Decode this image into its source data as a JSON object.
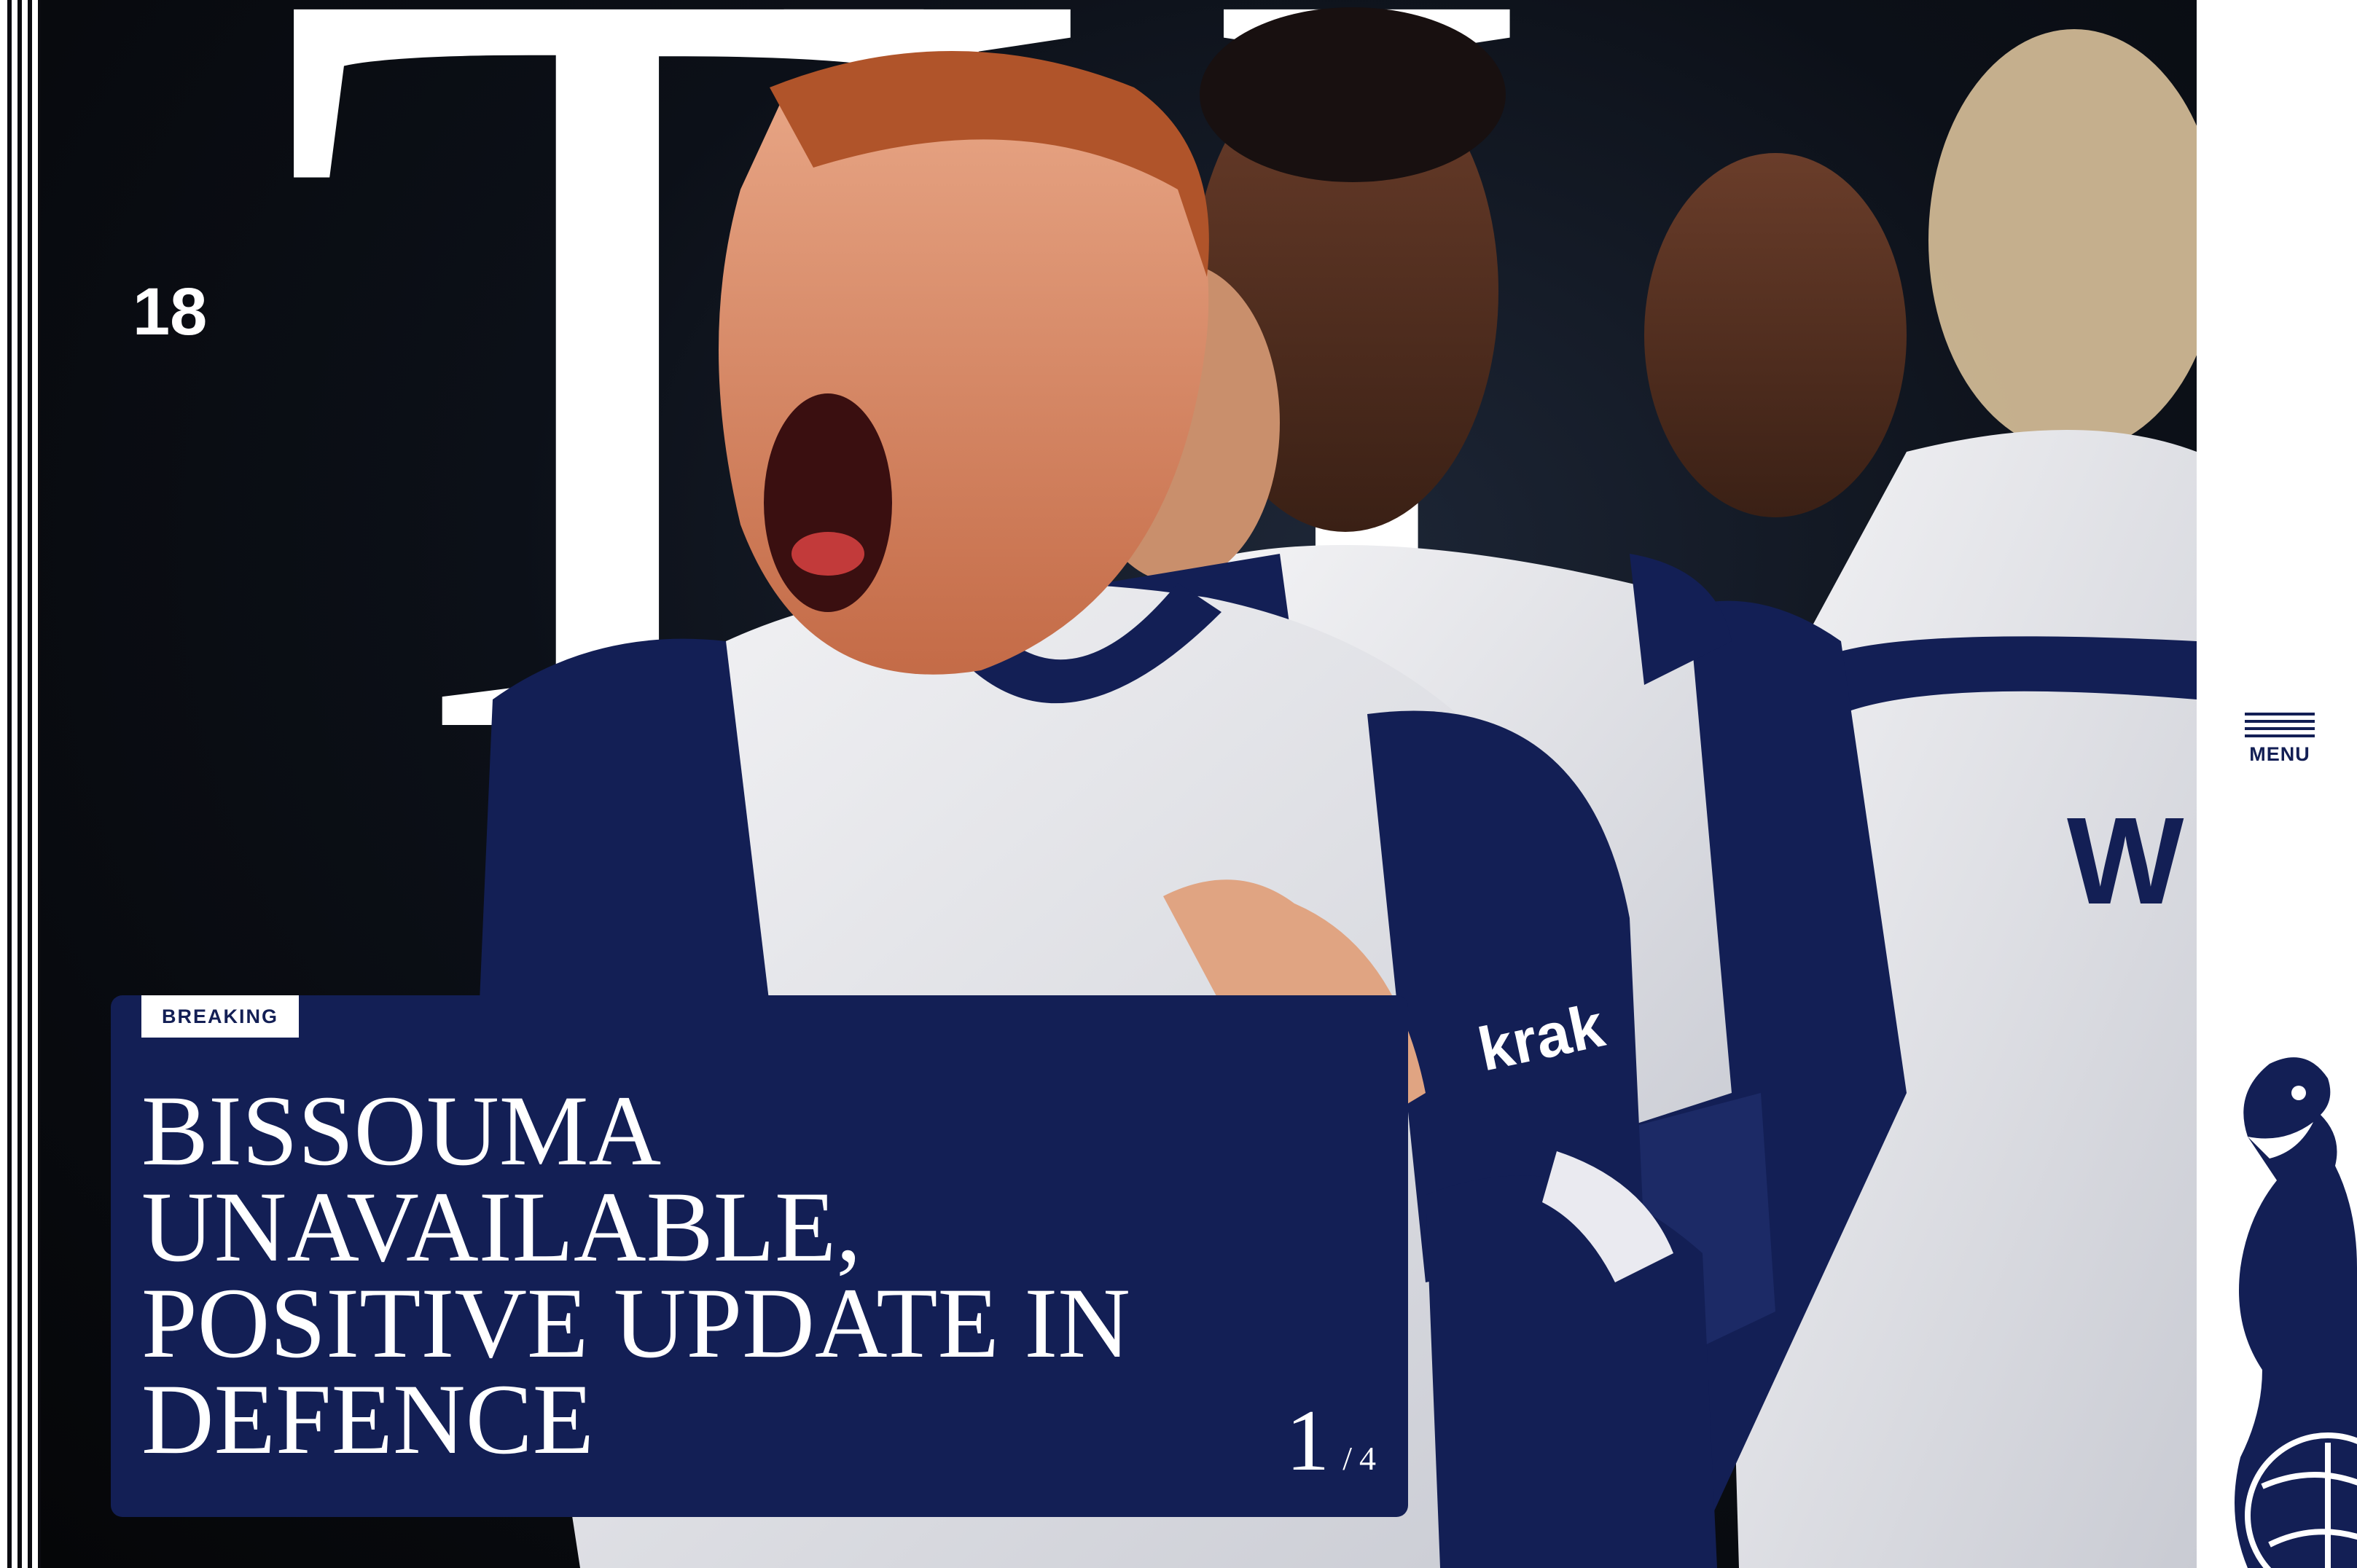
{
  "hero": {
    "year": "18",
    "initials": "TH"
  },
  "slide": {
    "badge": "BREAKING",
    "headline": "Bissouma unavailable, positive update in defence",
    "current": "1",
    "separator": "/",
    "total": "4"
  },
  "nav": {
    "menu_label": "MENU"
  },
  "colors": {
    "navy": "#131f55",
    "white": "#ffffff",
    "dark": "#0c1018"
  }
}
